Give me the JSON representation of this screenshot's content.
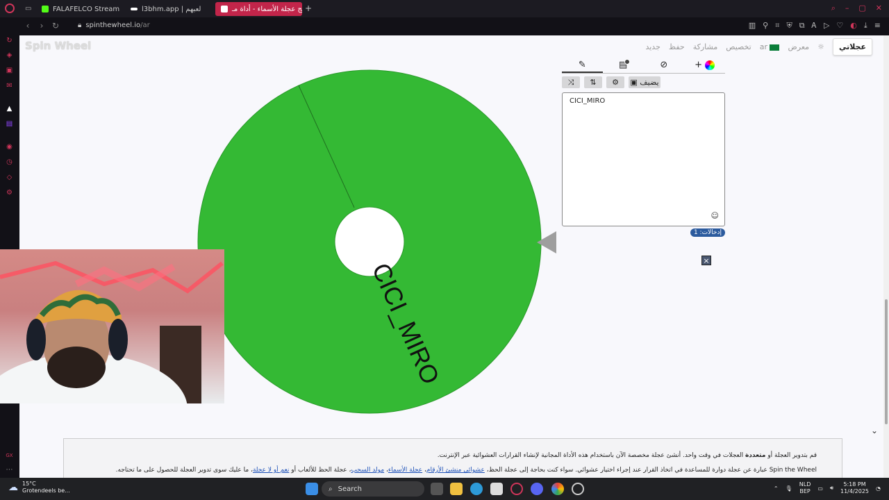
{
  "browser": {
    "tabs": [
      {
        "label": "FALAFELCO Stream - Wat",
        "icon": "kick-icon",
        "color": "#53fc18"
      },
      {
        "label": "l3bhm.app | لعبهم",
        "icon": "l3bhm-icon",
        "color": "#ffffff"
      },
      {
        "label": "برنامج عجلة الأسماء - أداة مـ",
        "icon": "spinthewheel-icon",
        "color": "#c2254a",
        "active": true
      }
    ],
    "url": "spinthewheel.io",
    "url_path": "/ar"
  },
  "site": {
    "logo": "Spin Wheel",
    "nav": {
      "my_wheels": "عجلاتي",
      "gallery": "معرض",
      "language": "ar",
      "customize": "تخصيص",
      "share": "مشاركة",
      "save": "حفظ",
      "new": "جديد"
    }
  },
  "wheel": {
    "segments": [
      {
        "label": "CICI_MIRO",
        "color": "#34b934"
      }
    ]
  },
  "editor": {
    "add_image_label": "يضيف",
    "entries_text": "CICI_MIRO",
    "count_label": "إدخالات: 1",
    "close": "×"
  },
  "info": {
    "line1_a": "قم بتدوير العجلة أو ",
    "line1_b": "متعددة",
    "line1_c": " العجلات في وقت واحد. أنشئ عجلة مخصصة الآن باستخدام هذه الأداة المجانية لإنشاء القرارات العشوائية عبر الإنترنت.",
    "line2_a": "Spin the Wheel",
    "line2_b": " عبارة عن عجلة دوارة للمساعدة في اتخاذ القرار عند إجراء اختيار عشوائي. سواء كنت بحاجة إلى عجلة الحظ، ",
    "link1": "عشوائي منشئ الأرقام",
    "sep1": "، ",
    "link2": "عجلة الأسماء",
    "sep2": "، ",
    "link3": "مولد السحب",
    "line2_c": "، عجلة الحظ للألعاب أو ",
    "link4": "نعم أو لا عجلة",
    "line2_d": "، ما عليك سوى تدوير العجلة للحصول على ما تحتاجه."
  },
  "taskbar": {
    "weather_temp": "15°C",
    "weather_desc": "Grotendeels be...",
    "search": "Search",
    "lang1": "NLD",
    "lang2": "BEP",
    "time": "5:18 PM",
    "date": "11/4/2025"
  }
}
